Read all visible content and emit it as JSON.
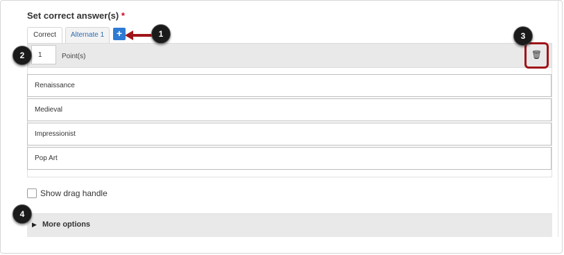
{
  "section": {
    "title": "Set correct answer(s)",
    "required_mark": "*"
  },
  "tabs": [
    {
      "label": "Correct",
      "active": true
    },
    {
      "label": "Alternate 1",
      "active": false
    }
  ],
  "add_button": {
    "icon": "plus-icon",
    "symbol": "+"
  },
  "points": {
    "value": "1",
    "label": "Point(s)"
  },
  "delete_button": {
    "icon": "trash-icon",
    "symbol": "🗑"
  },
  "answers": [
    "Renaissance",
    "Medieval",
    "Impressionist",
    "Pop Art"
  ],
  "drag_handle": {
    "label": "Show drag handle",
    "checked": false
  },
  "more_options": {
    "label": "More options",
    "icon": "triangle-right-icon",
    "symbol": "▶"
  },
  "callouts": [
    "1",
    "2",
    "3",
    "4"
  ],
  "colors": {
    "accent": "#2d7bd4",
    "callout_highlight": "#a01418",
    "required": "#d0021b"
  }
}
